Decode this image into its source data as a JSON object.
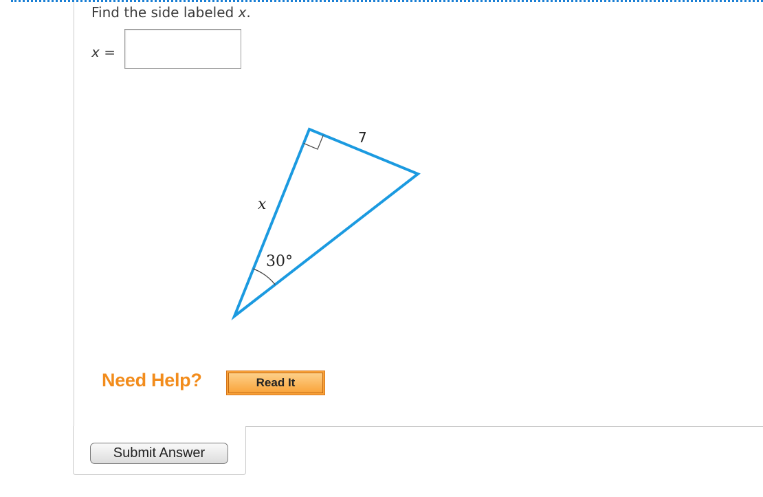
{
  "question": {
    "text": "Find the side labeled ",
    "variable": "x",
    "end": "."
  },
  "answer": {
    "label_var": "x",
    "label_eq": " =",
    "value": ""
  },
  "figure": {
    "side_label_hyp_adjacent": "x",
    "side_label_opposite": "7",
    "angle_label": "30°",
    "stroke_color": "#1b9ae0"
  },
  "help": {
    "prompt": "Need Help?",
    "read_it_label": "Read It"
  },
  "submit": {
    "label": "Submit Answer"
  },
  "colors": {
    "accent_orange": "#f28c1c",
    "focus_blue": "#1a7fd4"
  }
}
